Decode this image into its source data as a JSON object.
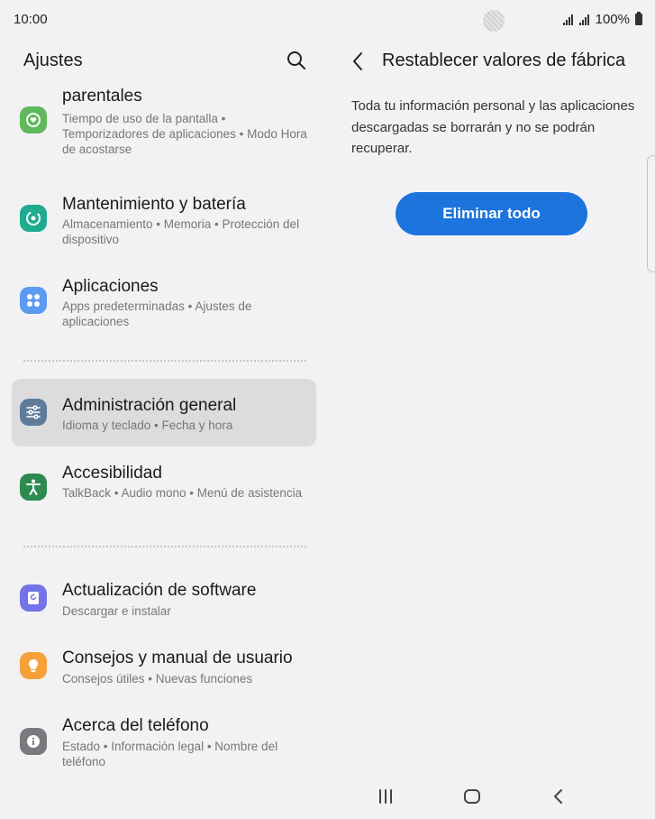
{
  "status_bar": {
    "time": "10:00",
    "battery_percent": "100%"
  },
  "left_pane": {
    "title": "Ajustes",
    "items": [
      {
        "title": "parentales",
        "subtitle": "Tiempo de uso de la pantalla  •  Temporizadores de aplicaciones  •  Modo Hora de acostarse",
        "icon": "wellbeing-icon",
        "color": "#5fb85a"
      },
      {
        "title": "Mantenimiento y batería",
        "subtitle": "Almacenamiento  •  Memoria  •  Protección del dispositivo",
        "icon": "device-care-icon",
        "color": "#1eab8f"
      },
      {
        "title": "Aplicaciones",
        "subtitle": "Apps predeterminadas  •  Ajustes de aplicaciones",
        "icon": "apps-icon",
        "color": "#5b9af0"
      },
      {
        "title": "Administración general",
        "subtitle": "Idioma y teclado  •  Fecha y hora",
        "icon": "sliders-icon",
        "color": "#5d7c9c"
      },
      {
        "title": "Accesibilidad",
        "subtitle": "TalkBack  •  Audio mono  •  Menú de asistencia",
        "icon": "accessibility-icon",
        "color": "#2e8b4f"
      },
      {
        "title": "Actualización de software",
        "subtitle": "Descargar e instalar",
        "icon": "software-update-icon",
        "color": "#7573e8"
      },
      {
        "title": "Consejos y manual de usuario",
        "subtitle": "Consejos útiles  •  Nuevas funciones",
        "icon": "lightbulb-icon",
        "color": "#f5a13a"
      },
      {
        "title": "Acerca del teléfono",
        "subtitle": "Estado  •  Información legal  •  Nombre del teléfono",
        "icon": "info-icon",
        "color": "#7a7a7e"
      }
    ]
  },
  "right_pane": {
    "title": "Restablecer valores de fábrica",
    "description": "Toda tu información personal y las aplicaciones descargadas se borrarán y no se podrán recuperar.",
    "button_label": "Eliminar todo",
    "accent_color": "#1c74dc"
  }
}
